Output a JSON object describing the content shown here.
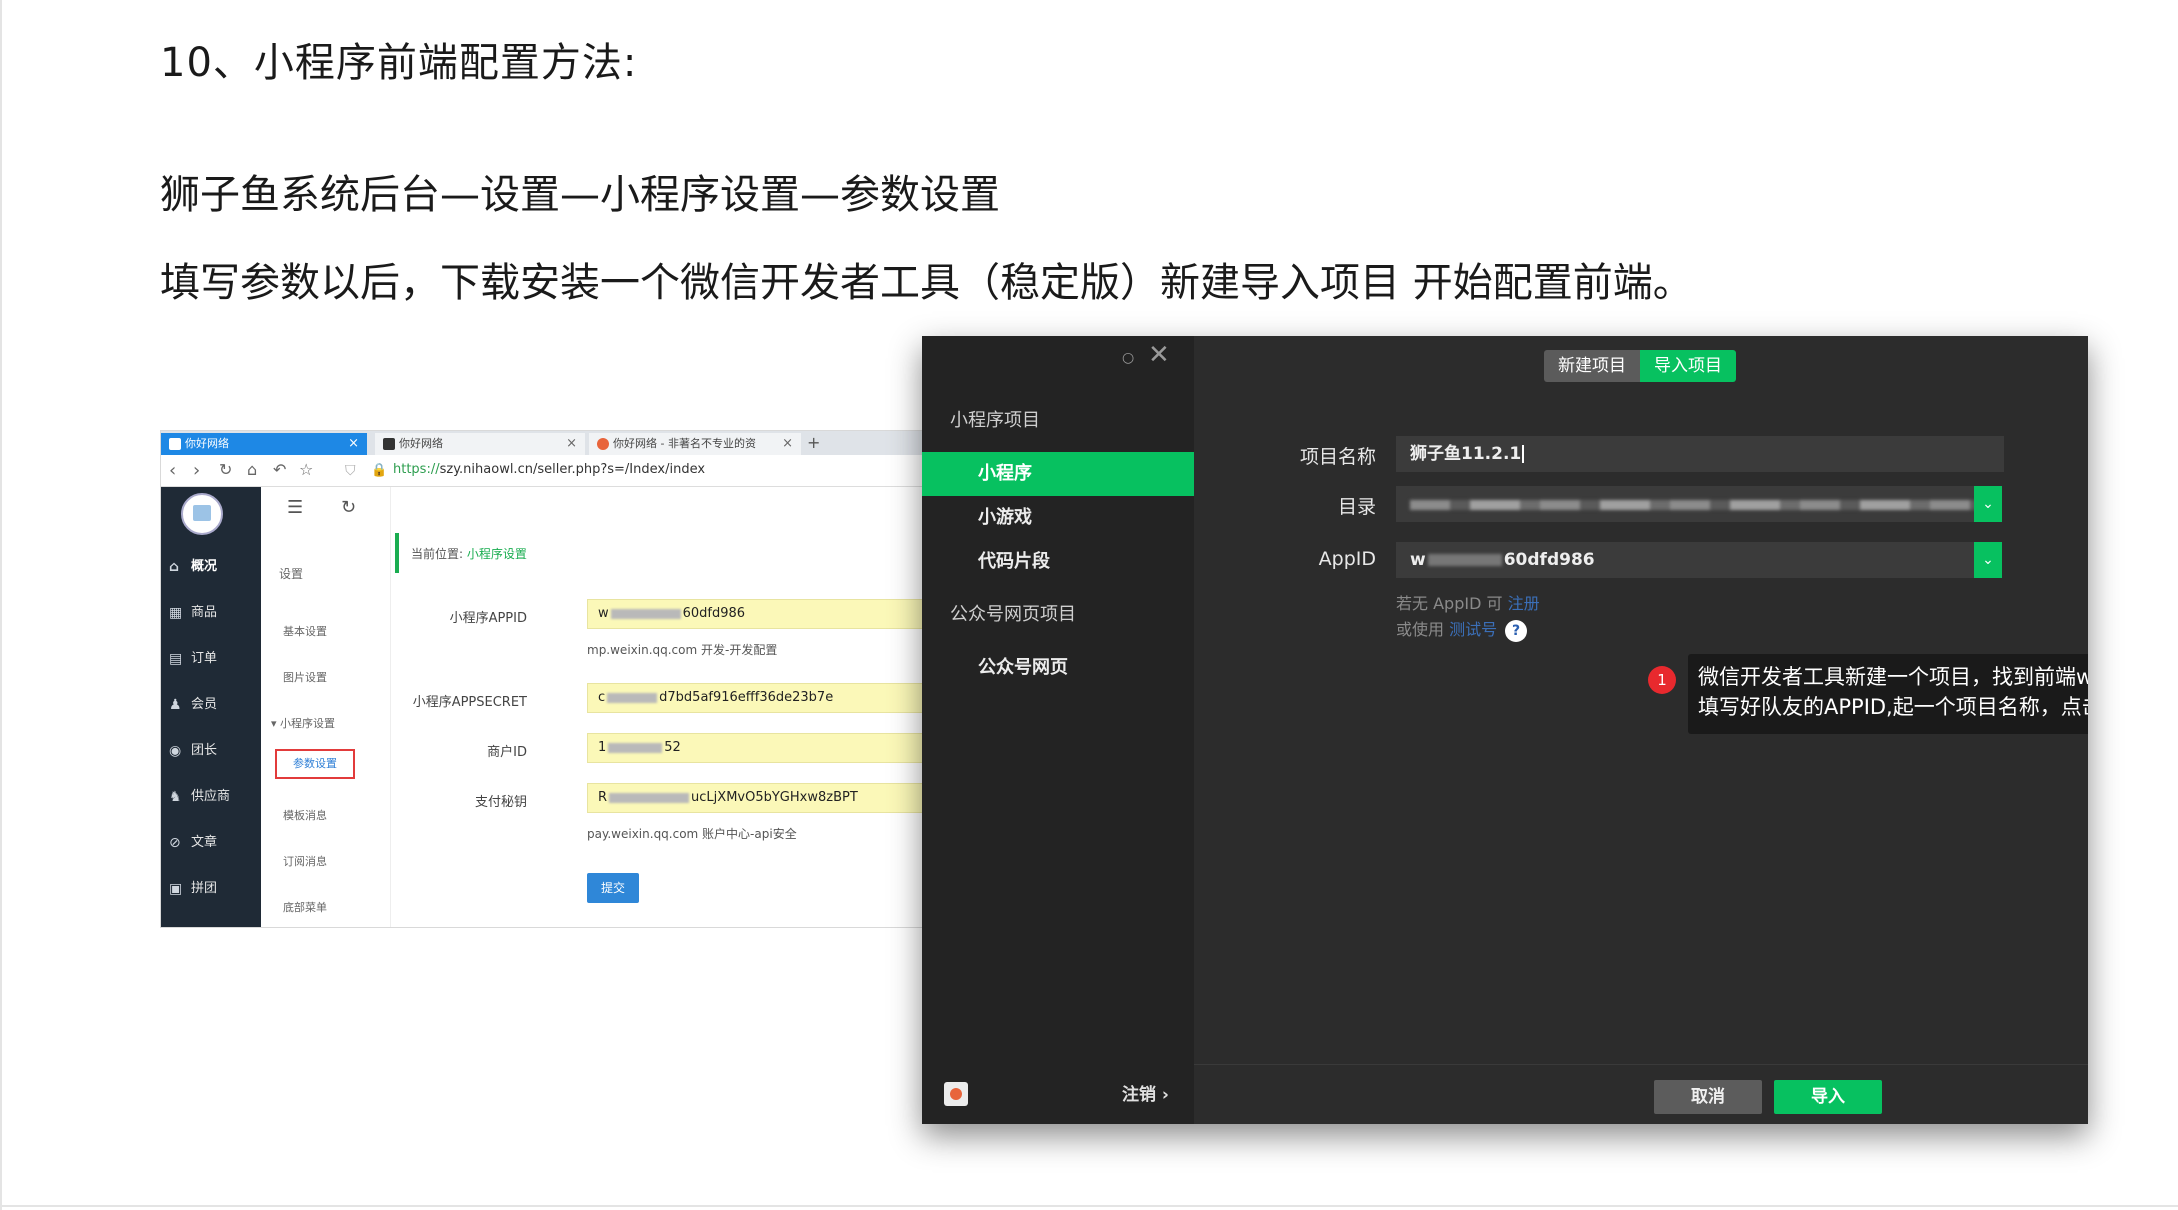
{
  "doc": {
    "step_heading": "10、小程序前端配置方法:",
    "path_line": "狮子鱼系统后台—设置—小程序设置—参数设置",
    "desc_line": "填写参数以后，下载安装一个微信开发者工具（稳定版）新建导入项目 开始配置前端。"
  },
  "browser": {
    "tabs": [
      {
        "label": "你好网络",
        "close": "×"
      },
      {
        "label": "你好网络",
        "close": "×"
      },
      {
        "label": "你好网络 - 非著名不专业的资",
        "close": "×"
      }
    ],
    "tab_plus": "+",
    "url_scheme": "https://",
    "url_rest": "szy.nihaowl.cn/seller.php?s=/Index/index",
    "sidebar": [
      {
        "icon": "home-icon",
        "glyph": "⌂",
        "label": "概况"
      },
      {
        "icon": "goods-icon",
        "glyph": "▦",
        "label": "商品"
      },
      {
        "icon": "order-icon",
        "glyph": "▤",
        "label": "订单"
      },
      {
        "icon": "member-icon",
        "glyph": "♟",
        "label": "会员"
      },
      {
        "icon": "leader-icon",
        "glyph": "◉",
        "label": "团长"
      },
      {
        "icon": "supplier-icon",
        "glyph": "♞",
        "label": "供应商"
      },
      {
        "icon": "article-icon",
        "glyph": "⊘",
        "label": "文章"
      },
      {
        "icon": "group-icon",
        "glyph": "▣",
        "label": "拼团"
      }
    ],
    "subnav": {
      "title": "设置",
      "items": [
        "基本设置",
        "图片设置",
        "▾ 小程序设置",
        "模板消息",
        "订阅消息",
        "底部菜单"
      ],
      "active": "参数设置"
    },
    "breadcrumb_prefix": "当前位置:",
    "breadcrumb_current": "小程序设置",
    "form": {
      "appid_label": "小程序APPID",
      "appid_prefix": "w",
      "appid_suffix": "60dfd986",
      "appid_hint": "mp.weixin.qq.com 开发-开发配置",
      "secret_label": "小程序APPSECRET",
      "secret_prefix": "c",
      "secret_suffix": "d7bd5af916efff36de23b7e",
      "mchid_label": "商户ID",
      "mchid_prefix": "1",
      "mchid_suffix": "52",
      "paykey_label": "支付秘钥",
      "paykey_prefix": "R",
      "paykey_suffix": "ucLjXMvO5bYGHxw8zBPT",
      "paykey_hint": "pay.weixin.qq.com 账户中心-api安全",
      "submit": "提交"
    }
  },
  "devtool": {
    "ctrl_dot": "○",
    "ctrl_close": "✕",
    "sections": [
      {
        "title": "小程序项目",
        "items": [
          "小程序",
          "小游戏",
          "代码片段"
        ]
      },
      {
        "title": "公众号网页项目",
        "items": [
          "公众号网页"
        ]
      }
    ],
    "logout": "注销 ›",
    "seg_new": "新建项目",
    "seg_import": "导入项目",
    "name_label": "项目名称",
    "name_value": "狮子鱼11.2.1",
    "dir_label": "目录",
    "appid_label": "AppID",
    "appid_prefix": "w",
    "appid_suffix": "60dfd986",
    "dropdown_glyph": "⌄",
    "hint1_text": "若无 AppID 可 ",
    "hint1_link": "注册",
    "hint2_text": "或使用 ",
    "hint2_link": "测试号",
    "qmark": "?",
    "badge": "1",
    "callout_line1": "微信开发者工具新建一个项目，找到前端wxapp文件夹，",
    "callout_line2": "填写好队友的APPID,起一个项目名称，点击导入即可",
    "cancel": "取消",
    "import": "导入"
  },
  "colors": {
    "wechat_green": "#07c160",
    "admin_green": "#1aad50",
    "tab_blue": "#1e88e5",
    "highlight_red": "#e23b3b"
  }
}
